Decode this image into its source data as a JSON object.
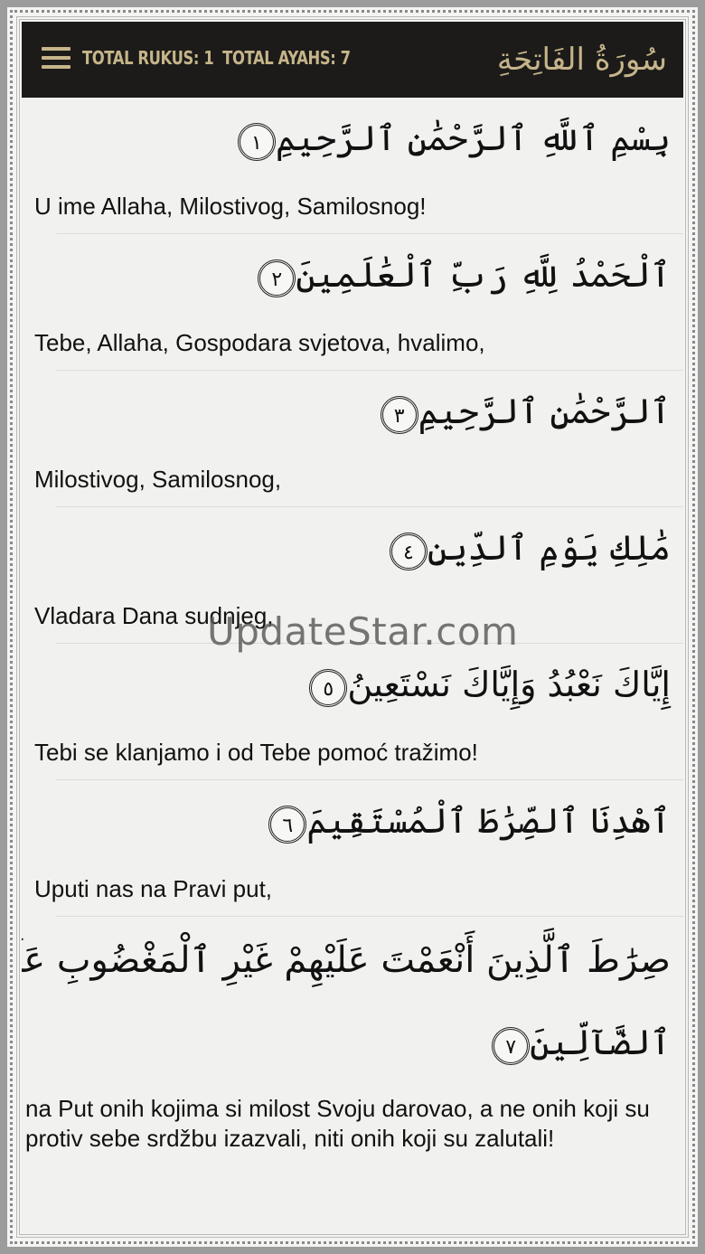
{
  "header": {
    "total_rukus": "TOTAL RUKUS: 1",
    "total_ayahs": "TOTAL AYAHS: 7",
    "surah_title": "سُورَةُ الفَاتِحَةِ"
  },
  "ayahs": [
    {
      "arabic": "بِسْمِ ٱللَّهِ ٱلرَّحْمَٰنِ ٱلرَّحِيمِ",
      "number": "١",
      "translation": "U ime Allaha, Milostivog, Samilosnog!"
    },
    {
      "arabic": "ٱلْحَمْدُ لِلَّهِ رَبِّ ٱلْعَٰلَمِينَ",
      "number": "٢",
      "translation": "Tebe, Allaha, Gospodara svjetova, hvalimo,"
    },
    {
      "arabic": "ٱلرَّحْمَٰنِ ٱلرَّحِيمِ",
      "number": "٣",
      "translation": "Milostivog, Samilosnog,"
    },
    {
      "arabic": "مَٰلِكِ يَوْمِ ٱلدِّينِ",
      "number": "٤",
      "translation": "Vladara Dana sudnjeg,"
    },
    {
      "arabic": "إِيَّاكَ نَعْبُدُ وَإِيَّاكَ نَسْتَعِينُ",
      "number": "٥",
      "translation": "Tebi se klanjamo i od Tebe pomoć tražimo!"
    },
    {
      "arabic": "ٱهْدِنَا ٱلصِّرَٰطَ ٱلْمُسْتَقِيمَ",
      "number": "٦",
      "translation": "Uputi nas na Pravi put,"
    },
    {
      "arabic": "صِرَٰطَ ٱلَّذِينَ أَنْعَمْتَ عَلَيْهِمْ غَيْرِ ٱلْمَغْضُوبِ عَلَيْهِمْ وَلَا",
      "arabic_cont": "ٱلضَّآلِّينَ",
      "number": "٧",
      "translation": "na Put onih kojima si milost Svoju darovao, a ne onih koji su protiv sebe srdžbu izazvali, niti onih koji su zalutali!"
    }
  ],
  "watermark": "UpdateStar.com"
}
